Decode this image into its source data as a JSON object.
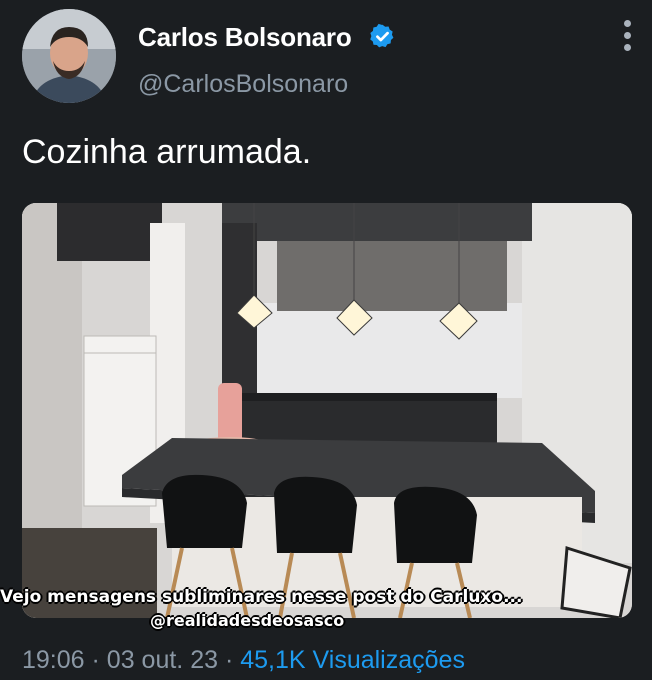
{
  "author": {
    "display_name": "Carlos Bolsonaro",
    "handle": "@CarlosBolsonaro",
    "verified": true,
    "verified_color": "#1d9bf0"
  },
  "tweet": {
    "text": "Cozinha arrumada.",
    "media": {
      "alt_semantic": "kitchen-photo"
    }
  },
  "overlay_caption": {
    "line1": "Vejo mensagens subliminares nesse post do Carluxo...",
    "line2": "@realidadesdeosasco"
  },
  "meta": {
    "time": "19:06",
    "date": "03 out. 23",
    "views_count": "45,1K",
    "views_label": "Visualizações",
    "separator": "·"
  },
  "icons": {
    "more": "more-vertical-icon",
    "verified": "verified-badge-icon"
  }
}
